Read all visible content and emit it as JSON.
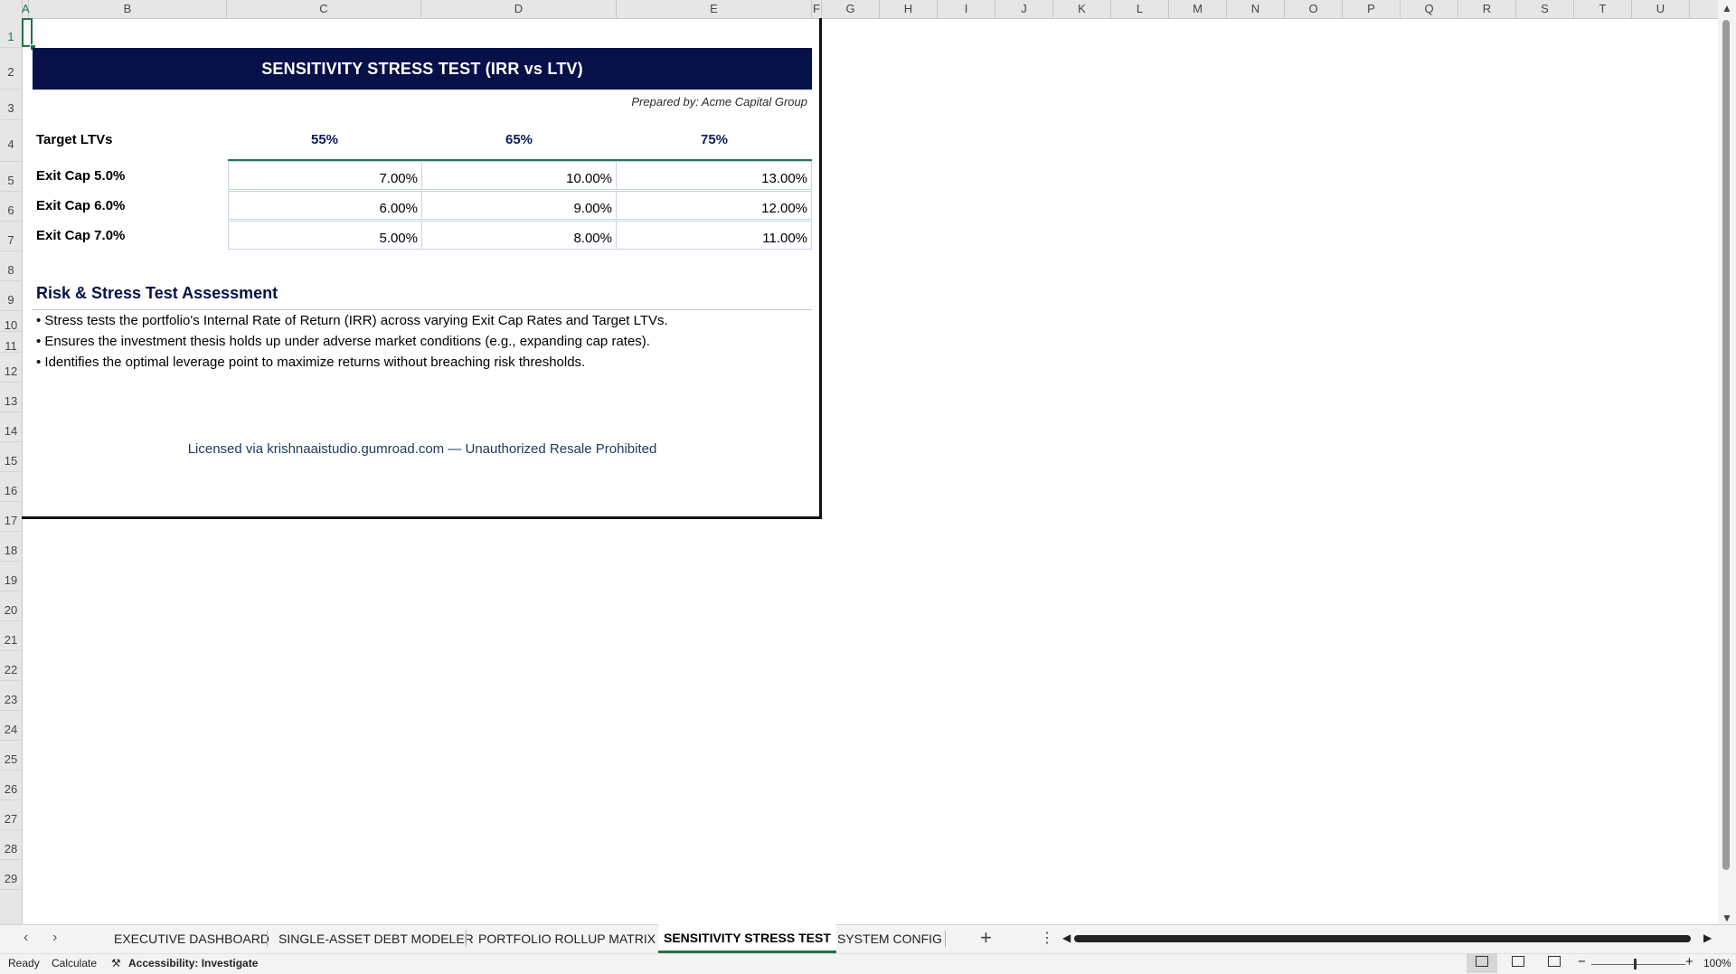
{
  "columns": [
    "A",
    "B",
    "C",
    "D",
    "E",
    "F",
    "G",
    "H",
    "I",
    "J",
    "K",
    "L",
    "M",
    "N",
    "O",
    "P",
    "Q",
    "R",
    "S",
    "T",
    "U"
  ],
  "rows": [
    "1",
    "2",
    "3",
    "4",
    "5",
    "6",
    "7",
    "8",
    "9",
    "10",
    "11",
    "12",
    "13",
    "14",
    "15",
    "16",
    "17",
    "18",
    "19",
    "20",
    "21",
    "22",
    "23",
    "24",
    "25",
    "26",
    "27",
    "28",
    "29"
  ],
  "sheet": {
    "title": "SENSITIVITY STRESS TEST (IRR vs LTV)",
    "prepared_by": "Prepared by: Acme Capital Group",
    "target_ltvs_label": "Target LTVs",
    "ltvs": [
      "55%",
      "65%",
      "75%"
    ],
    "exit_caps": [
      {
        "label": "Exit Cap 5.0%",
        "values": [
          "7.00%",
          "10.00%",
          "13.00%"
        ]
      },
      {
        "label": "Exit Cap 6.0%",
        "values": [
          "6.00%",
          "9.00%",
          "12.00%"
        ]
      },
      {
        "label": "Exit Cap 7.0%",
        "values": [
          "5.00%",
          "8.00%",
          "11.00%"
        ]
      }
    ],
    "risk_title": "Risk & Stress Test Assessment",
    "bullets": [
      "• Stress tests the portfolio's Internal Rate of Return (IRR) across varying Exit Cap Rates and Target LTVs.",
      "• Ensures the investment thesis holds up under adverse market conditions (e.g., expanding cap rates).",
      "• Identifies the optimal leverage point to maximize returns without breaching risk thresholds."
    ],
    "license": "Licensed via krishnaaistudio.gumroad.com — Unauthorized Resale Prohibited"
  },
  "tabs": {
    "prev_icon": "chevron-left-icon",
    "next_icon": "chevron-right-icon",
    "items": [
      "EXECUTIVE DASHBOARD",
      "SINGLE-ASSET DEBT MODELER",
      "PORTFOLIO ROLLUP MATRIX",
      "SENSITIVITY STRESS TEST",
      "SYSTEM CONFIG"
    ],
    "active": "SENSITIVITY STRESS TEST",
    "add_label": "+",
    "more_label": "⋮"
  },
  "status": {
    "ready": "Ready",
    "calculate": "Calculate",
    "accessibility": "Accessibility: Investigate",
    "zoom_minus": "−",
    "zoom_plus": "+",
    "zoom_level": "100%"
  },
  "colors": {
    "title_bg": "#06114a",
    "accent_green": "#217346",
    "heading_blue": "#0b1e5b"
  }
}
